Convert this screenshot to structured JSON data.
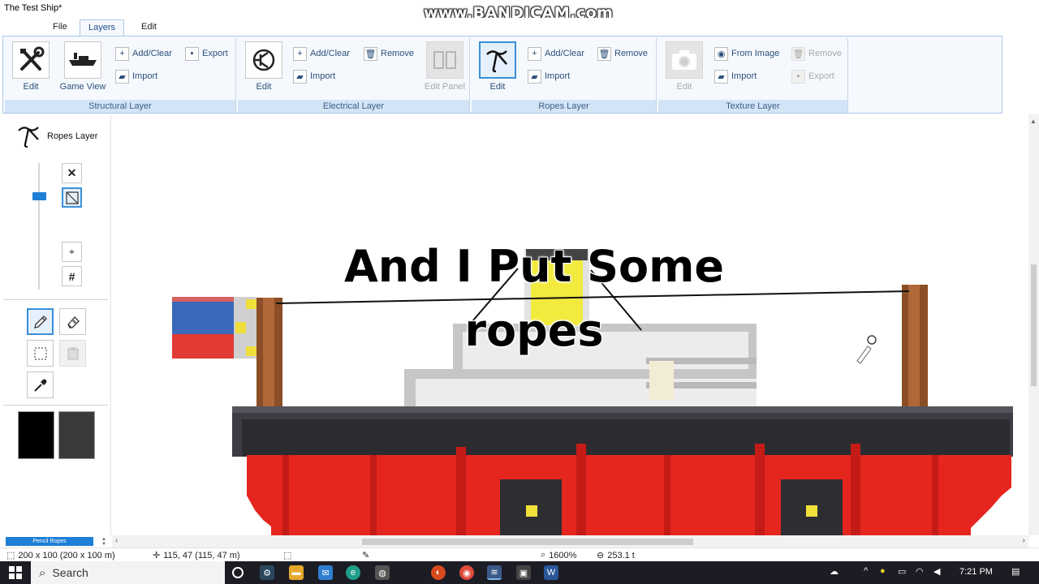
{
  "window": {
    "title": "The Test Ship*"
  },
  "watermark": "www.BANDICAM.com",
  "menu": {
    "tabs": [
      {
        "label": "File"
      },
      {
        "label": "Layers"
      },
      {
        "label": "Edit"
      }
    ],
    "active": "Layers"
  },
  "ribbon": {
    "structural": {
      "label": "Structural Layer",
      "edit": "Edit",
      "game_view": "Game View",
      "add_clear": "Add/Clear",
      "import": "Import",
      "export": "Export"
    },
    "electrical": {
      "label": "Electrical Layer",
      "edit": "Edit",
      "add_clear": "Add/Clear",
      "import": "Import",
      "remove": "Remove",
      "edit_panel": "Edit Panel"
    },
    "ropes": {
      "label": "Ropes Layer",
      "edit": "Edit",
      "add_clear": "Add/Clear",
      "import": "Import",
      "remove": "Remove"
    },
    "texture": {
      "label": "Texture Layer",
      "edit": "Edit",
      "from_image": "From Image",
      "import": "Import",
      "remove": "Remove",
      "export": "Export"
    }
  },
  "left_panel": {
    "current_layer": "Ropes Layer",
    "primary_color": "#000000",
    "secondary_color": "#3a3a3a",
    "tool_mode": "Pencil Ropes"
  },
  "canvas": {
    "caption_line1": "And I Put Some",
    "caption_line2": "ropes"
  },
  "status": {
    "ship_size": "200 x 100 (200 x 100 m)",
    "cursor": "115, 47 (115, 47 m)",
    "zoom": "1600%",
    "mass": "253.1 t"
  },
  "taskbar": {
    "search_placeholder": "Search",
    "time": "7:21 PM"
  }
}
